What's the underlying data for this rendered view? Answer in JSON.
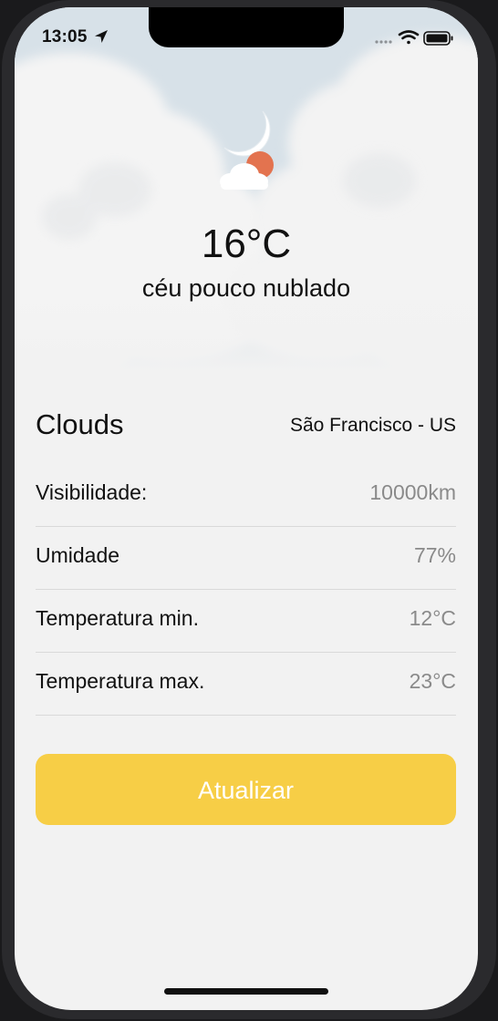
{
  "status_bar": {
    "time": "13:05"
  },
  "current": {
    "temperature": "16°C",
    "description": "céu pouco nublado"
  },
  "summary": {
    "main": "Clouds",
    "location": "São Francisco - US"
  },
  "details": [
    {
      "label": "Visibilidade:",
      "value": "10000km"
    },
    {
      "label": "Umidade",
      "value": "77%"
    },
    {
      "label": "Temperatura min.",
      "value": "12°C"
    },
    {
      "label": "Temperatura max.",
      "value": "23°C"
    }
  ],
  "refresh_button": {
    "label": "Atualizar",
    "color": "#f7ce46"
  },
  "icons": {
    "weather": "cloud-moon-sun-icon",
    "location_arrow": "location-arrow-icon",
    "wifi": "wifi-icon",
    "battery": "battery-icon",
    "signal": "signal-dots-icon"
  }
}
